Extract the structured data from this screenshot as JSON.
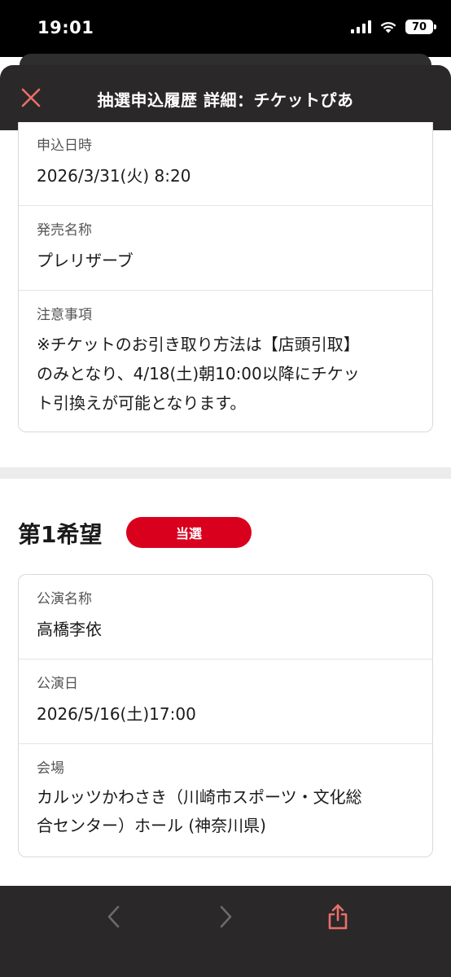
{
  "status_bar": {
    "time": "19:01",
    "battery": "70"
  },
  "header": {
    "title": "抽選申込履歴 詳細：チケットぴあ"
  },
  "application_info": {
    "rows": [
      {
        "label": "申込日時",
        "value": "2026/3/31(火) 8:20"
      },
      {
        "label": "発売名称",
        "value": "プレリザーブ"
      },
      {
        "label": "注意事項",
        "lines": [
          "※チケットのお引き取り方法は【店頭引取】",
          "のみとなり、4/18(土)朝10:00以降にチケッ",
          "ト引換えが可能となります。"
        ]
      }
    ]
  },
  "choice": {
    "title": "第1希望",
    "result": "当選",
    "rows": [
      {
        "label": "公演名称",
        "value": "高橋李依"
      },
      {
        "label": "公演日",
        "value": "2026/5/16(土)17:00"
      },
      {
        "label": "会場",
        "lines": [
          "カルッツかわさき（川崎市スポーツ・文化総",
          "合センター）ホール (神奈川県)"
        ]
      }
    ]
  },
  "icons": {
    "close": "close-icon",
    "back": "chevron-left-icon",
    "forward": "chevron-right-icon",
    "share": "share-icon"
  },
  "colors": {
    "accent_red": "#d8001d",
    "close_icon": "#e8706a",
    "header_bg": "#2a2828"
  }
}
